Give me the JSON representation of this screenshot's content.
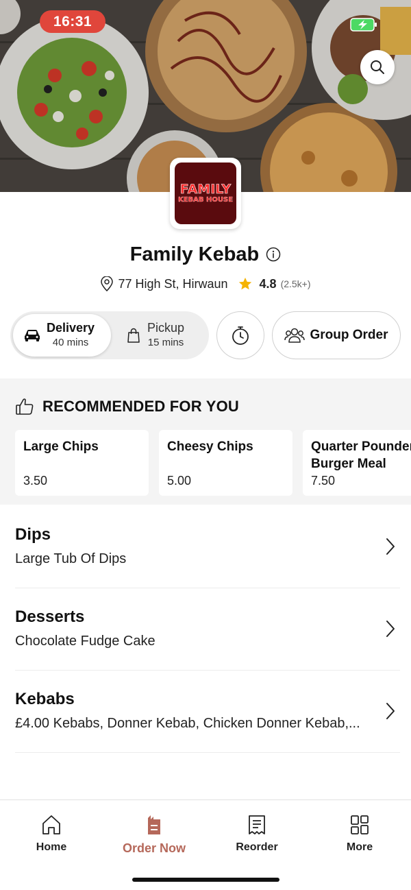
{
  "status_bar": {
    "time": "16:31",
    "time_badge_color": "#e0463b",
    "battery_icon": "battery-charging-icon",
    "battery_color": "#4cd964"
  },
  "hero": {
    "search_icon": "search-icon"
  },
  "restaurant": {
    "logo_text_line1": "FAMILY",
    "logo_text_line2": "KEBAB HOUSE",
    "logo_bg_color": "#5a0b0e",
    "name": "Family Kebab",
    "address": "77 High St, Hirwaun",
    "rating": "4.8",
    "rating_count": "(2.5k+)",
    "star_color": "#f5b301"
  },
  "fulfilment": {
    "selected": "Delivery",
    "delivery": {
      "label": "Delivery",
      "time": "40 mins"
    },
    "pickup": {
      "label": "Pickup",
      "time": "15 mins"
    },
    "group_order_label": "Group Order"
  },
  "recommended": {
    "title": "RECOMMENDED FOR YOU",
    "items": [
      {
        "name": "Large Chips",
        "price": "3.50"
      },
      {
        "name": "Cheesy Chips",
        "price": "5.00"
      },
      {
        "name": "Quarter Pounder\nBurger Meal",
        "name_line1": "Quarter Pounder",
        "name_line2": "Burger Meal",
        "price": "7.50"
      }
    ]
  },
  "categories": [
    {
      "name": "Dips",
      "description": "Large Tub Of Dips"
    },
    {
      "name": "Desserts",
      "description": "Chocolate Fudge Cake"
    },
    {
      "name": "Kebabs",
      "description": "£4.00 Kebabs, Donner Kebab, Chicken Donner Kebab,..."
    }
  ],
  "nav": {
    "active": "Order Now",
    "accent_color": "#b5685a",
    "items": [
      {
        "label": "Home",
        "icon": "home-icon"
      },
      {
        "label": "Order Now",
        "icon": "order-bag-icon"
      },
      {
        "label": "Reorder",
        "icon": "receipt-icon"
      },
      {
        "label": "More",
        "icon": "grid-icon"
      }
    ]
  }
}
